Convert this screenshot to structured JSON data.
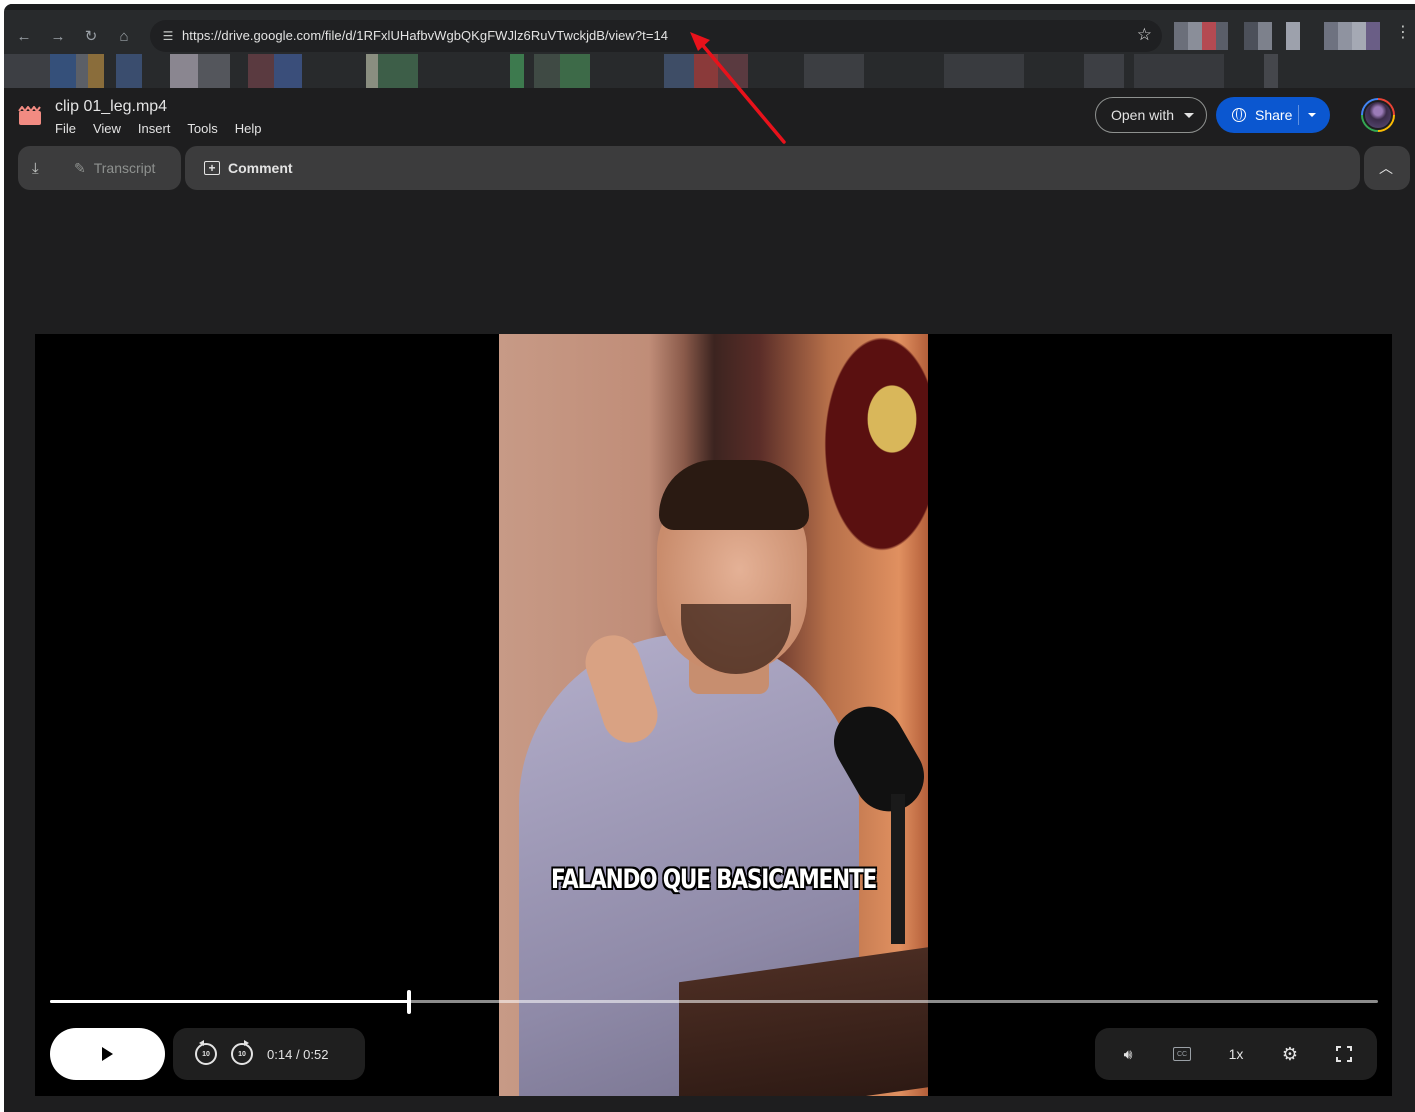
{
  "browser": {
    "url": "https://drive.google.com/file/d/1RFxlUHafbvWgbQKgFWJlz6RuVTwckjdB/view?t=14",
    "back_icon": "arrow-left-icon",
    "forward_icon": "arrow-right-icon",
    "reload_icon": "reload-icon",
    "home_icon": "home-icon",
    "site_info_icon": "tune-icon",
    "bookmark_icon": "star-icon",
    "extensions_pixelated": true,
    "bookmarks_pixelated": true
  },
  "drive": {
    "file_name": "clip 01_leg.mp4",
    "file_icon": "video-file-icon",
    "file_icon_color": "#f28b82",
    "menu": [
      "File",
      "View",
      "Insert",
      "Tools",
      "Help"
    ],
    "open_with_label": "Open with",
    "share_label": "Share",
    "share_color": "#0b57d0",
    "toolbar": {
      "download_icon": "download-icon",
      "transcript_label": "Transcript",
      "comment_label": "Comment",
      "collapse_icon": "chevron-up-icon"
    }
  },
  "player": {
    "subtitle": "FALANDO QUE BASICAMENTE",
    "current_time": "0:14",
    "duration": "/ 0:52",
    "progress_fraction": 0.27,
    "rewind_label": "10",
    "forward_label": "10",
    "speed_label": "1x",
    "cc_label": "CC"
  },
  "annotation": {
    "arrow_color": "#e8121b"
  }
}
